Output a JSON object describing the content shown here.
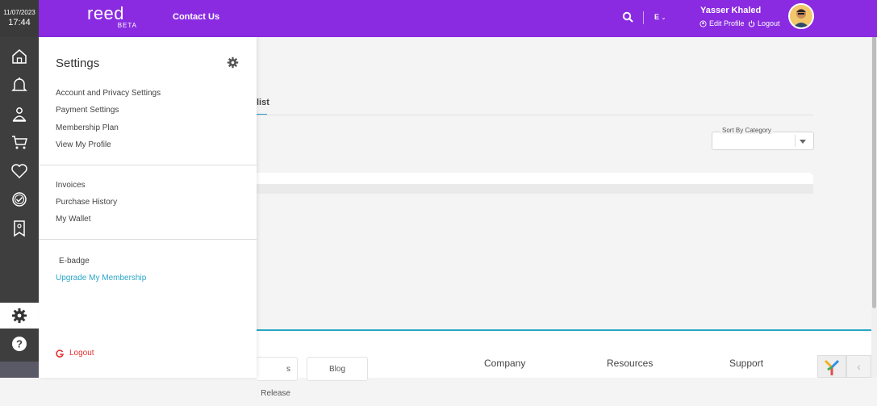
{
  "header": {
    "date": "11/07/2023",
    "time": "17:44",
    "logo_text": "reed",
    "logo_beta": "BETA",
    "contact_label": "Contact Us",
    "language": "E",
    "user_name": "Yasser Khaled",
    "edit_profile_label": "Edit Profile",
    "logout_label": "Logout"
  },
  "rail": {
    "icons": [
      "home-icon",
      "bell-icon",
      "user-badge-icon",
      "cart-icon",
      "heart-icon",
      "check-circle-icon",
      "bookmark-icon",
      "gear-icon",
      "help-icon"
    ]
  },
  "settings_panel": {
    "title": "Settings",
    "group1": [
      "Account and Privacy Settings",
      "Payment Settings",
      "Membership Plan",
      "View My Profile"
    ],
    "group2": [
      "Invoices",
      "Purchase History",
      "My Wallet"
    ],
    "group3": [
      "E-badge",
      "Upgrade My Membership"
    ],
    "logout_label": "Logout"
  },
  "background_page": {
    "tab_fragment": "list",
    "sort_label": "Sort By Category",
    "footer_buttons": [
      "s Release",
      "Blog"
    ],
    "footer_columns": [
      "Company",
      "Resources",
      "Support"
    ]
  },
  "colors": {
    "header_bg": "#8a2be2",
    "rail_bg": "#3e3e3e",
    "accent": "#2ba6c8",
    "logout": "#e03030"
  }
}
